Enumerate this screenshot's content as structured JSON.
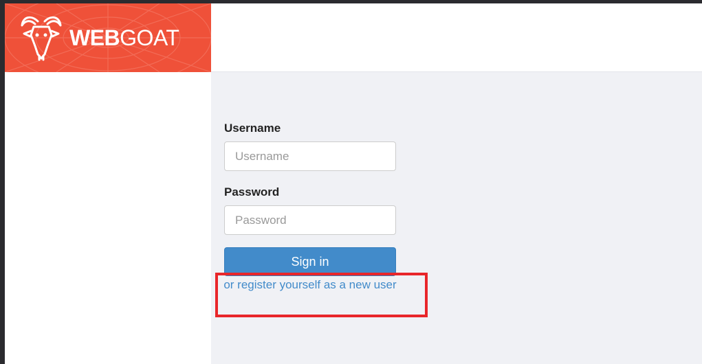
{
  "brand": {
    "name_bold": "WEB",
    "name_light": "GOAT",
    "icon": "goat-head-icon",
    "color": "#ef5139"
  },
  "login": {
    "username_label": "Username",
    "username_placeholder": "Username",
    "username_value": "",
    "password_label": "Password",
    "password_placeholder": "Password",
    "password_value": "",
    "signin_label": "Sign in",
    "register_link": "or register yourself as a new user"
  },
  "colors": {
    "primary": "#428bca",
    "highlight": "#e8262a",
    "content_bg": "#f0f1f5"
  }
}
